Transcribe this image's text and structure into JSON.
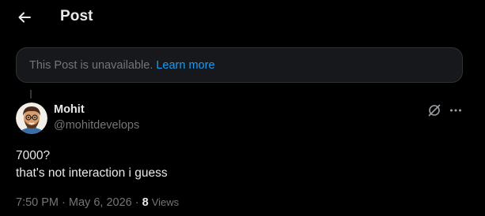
{
  "header": {
    "title": "Post",
    "back_icon": "arrow-left-icon"
  },
  "notice": {
    "text": "This Post is unavailable.",
    "link": "Learn more"
  },
  "post": {
    "author": {
      "name": "Mohit",
      "handle": "@mohitdevelops",
      "avatar": "cartoon-avatar"
    },
    "lines": [
      "7000?",
      "that's not interaction i guess"
    ],
    "time": "7:50 PM",
    "separator": "·",
    "date": "May 6, 2026",
    "views_count": "8",
    "views_label": "Views"
  },
  "icons": {
    "grok": "grok-icon",
    "more": "more-options-icon"
  },
  "colors": {
    "background": "#000000",
    "text": "#e7e9ea",
    "secondary": "#71767b",
    "link": "#1d9bf0",
    "card": "#16181c",
    "border": "#2f3336"
  }
}
